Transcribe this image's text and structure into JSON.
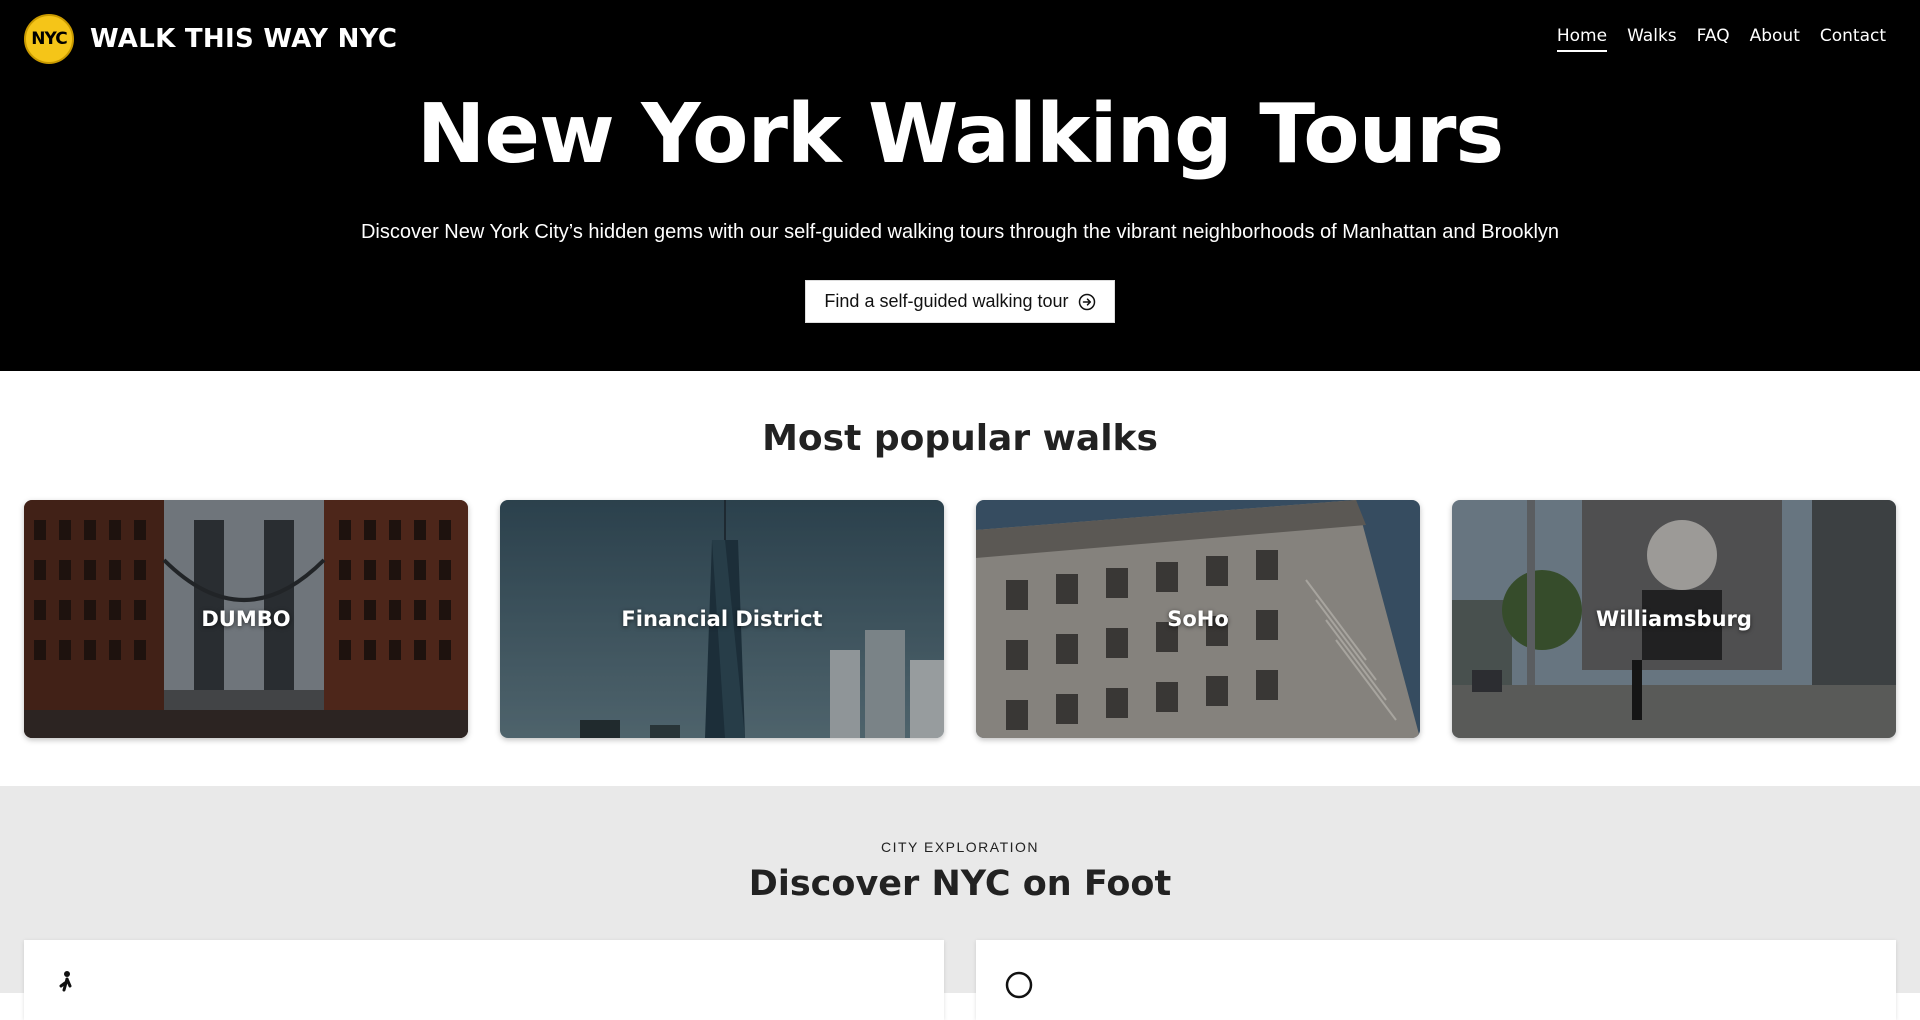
{
  "header": {
    "logo_text": "NYC",
    "brand": "WALK THIS WAY NYC",
    "nav": [
      {
        "label": "Home",
        "active": true
      },
      {
        "label": "Walks",
        "active": false
      },
      {
        "label": "FAQ",
        "active": false
      },
      {
        "label": "About",
        "active": false
      },
      {
        "label": "Contact",
        "active": false
      }
    ]
  },
  "hero": {
    "title": "New York Walking Tours",
    "subtitle": "Discover New York City’s hidden gems with our self-guided walking tours through the vibrant neighborhoods of Manhattan and Brooklyn",
    "cta_label": "Find a self-guided walking tour",
    "cta_icon": "arrow-right-circle-icon"
  },
  "popular": {
    "title": "Most popular walks",
    "walks": [
      {
        "name": "DUMBO"
      },
      {
        "name": "Financial District"
      },
      {
        "name": "SoHo"
      },
      {
        "name": "Williamsburg"
      }
    ]
  },
  "explore": {
    "eyebrow": "CITY EXPLORATION",
    "title": "Discover NYC on Foot",
    "features": [
      {
        "icon": "walking-person-icon"
      },
      {
        "icon": "circle-icon"
      }
    ]
  },
  "colors": {
    "hero_bg": "#000000",
    "logo_yellow": "#f5c518",
    "explore_bg": "#e9e9e9"
  }
}
